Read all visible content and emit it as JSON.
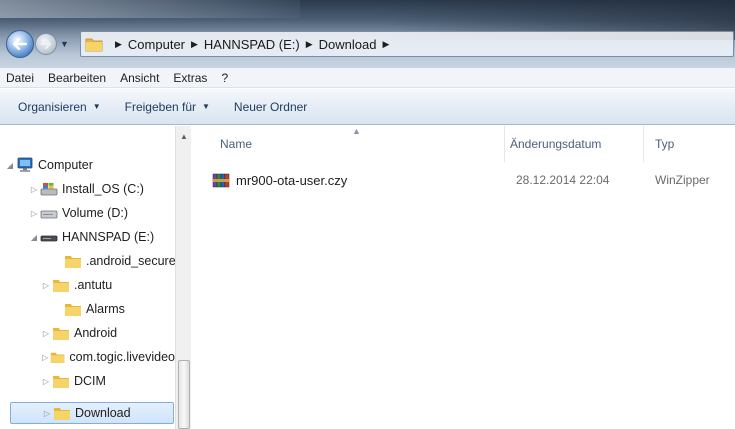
{
  "address_bar": {
    "crumbs": [
      "Computer",
      "HANNSPAD (E:)",
      "Download"
    ]
  },
  "menubar": {
    "items": [
      "Datei",
      "Bearbeiten",
      "Ansicht",
      "Extras",
      "?"
    ]
  },
  "commandbar": {
    "organize": "Organisieren",
    "share": "Freigeben für",
    "new_folder": "Neuer Ordner"
  },
  "navtree": {
    "items": [
      {
        "label": "Computer",
        "icon": "computer-icon",
        "level": 0,
        "expanded": true
      },
      {
        "label": "Install_OS (C:)",
        "icon": "drive-os-icon",
        "level": 1,
        "expanded": false
      },
      {
        "label": "Volume (D:)",
        "icon": "drive-icon",
        "level": 1,
        "expanded": false
      },
      {
        "label": "HANNSPAD (E:)",
        "icon": "removable-drive-icon",
        "level": 1,
        "expanded": true
      },
      {
        "label": ".android_secure",
        "icon": "folder-icon",
        "level": 2,
        "expanded": null
      },
      {
        "label": ".antutu",
        "icon": "folder-icon",
        "level": 2,
        "expanded": false
      },
      {
        "label": "Alarms",
        "icon": "folder-icon",
        "level": 2,
        "expanded": null
      },
      {
        "label": "Android",
        "icon": "folder-icon",
        "level": 2,
        "expanded": false
      },
      {
        "label": "com.togic.livevideo",
        "icon": "folder-icon",
        "level": 2,
        "expanded": false
      },
      {
        "label": "DCIM",
        "icon": "folder-icon",
        "level": 2,
        "expanded": false
      },
      {
        "label": "Download",
        "icon": "folder-icon",
        "level": 2,
        "expanded": false,
        "selected": true
      }
    ]
  },
  "content": {
    "columns": {
      "name": "Name",
      "date": "Änderungsdatum",
      "type": "Typ"
    },
    "files": [
      {
        "name": "mr900-ota-user.czy",
        "date": "28.12.2014 22:04",
        "type": "WinZipper",
        "icon": "archive-icon"
      }
    ]
  },
  "colors": {
    "folder": "#e8b83c",
    "selection_bg": "#cfe4fb",
    "selection_border": "#84acdd",
    "header_text": "#4c607a"
  }
}
